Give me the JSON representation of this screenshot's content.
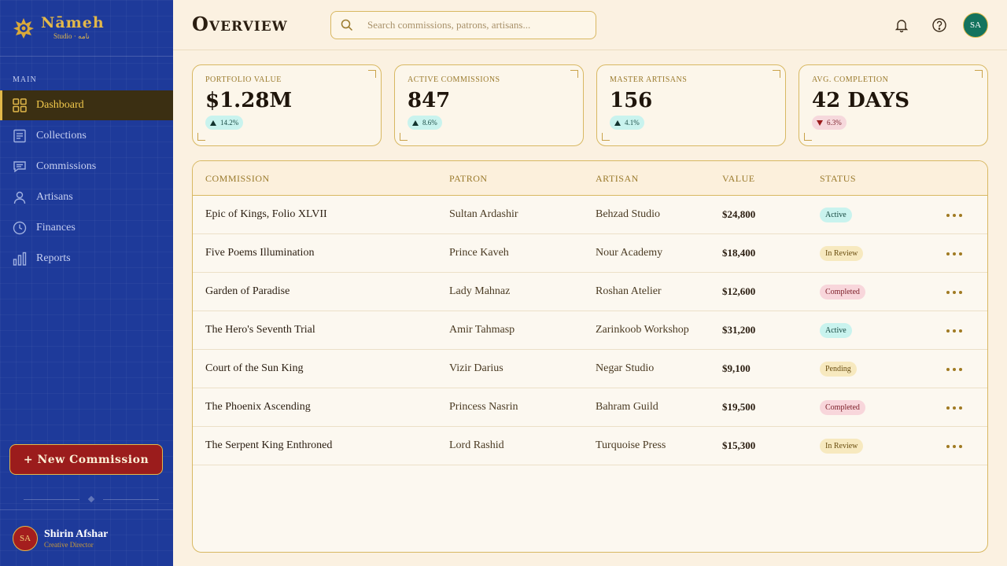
{
  "brand": {
    "name": "Nāmeh",
    "sub": "Studio · نامه"
  },
  "sidebar": {
    "section_label": "MAIN",
    "items": [
      {
        "label": "Dashboard",
        "icon": "grid-icon",
        "active": true
      },
      {
        "label": "Collections",
        "icon": "document-icon"
      },
      {
        "label": "Commissions",
        "icon": "chat-icon"
      },
      {
        "label": "Artisans",
        "icon": "person-icon"
      },
      {
        "label": "Finances",
        "icon": "clock-icon"
      },
      {
        "label": "Reports",
        "icon": "bar-chart-icon"
      }
    ],
    "new_button": "+ New Commission",
    "user": {
      "initials": "SA",
      "name": "Shirin Afshar",
      "role": "Creative Director"
    }
  },
  "header": {
    "title": "Overview",
    "search_placeholder": "Search commissions, patrons, artisans...",
    "avatar_initials": "SA"
  },
  "stats": [
    {
      "label": "PORTFOLIO VALUE",
      "value": "$1.28M",
      "change": "14.2%",
      "direction": "up"
    },
    {
      "label": "ACTIVE COMMISSIONS",
      "value": "847",
      "change": "8.6%",
      "direction": "up"
    },
    {
      "label": "MASTER ARTISANS",
      "value": "156",
      "change": "4.1%",
      "direction": "up"
    },
    {
      "label": "AVG. COMPLETION",
      "value": "42 DAYS",
      "change": "6.3%",
      "direction": "down"
    }
  ],
  "table": {
    "columns": [
      "COMMISSION",
      "PATRON",
      "ARTISAN",
      "VALUE",
      "STATUS"
    ],
    "rows": [
      {
        "commission": "Epic of Kings, Folio XLVII",
        "patron": "Sultan Ardashir",
        "artisan": "Behzad Studio",
        "value": "$24,800",
        "status": "Active"
      },
      {
        "commission": "Five Poems Illumination",
        "patron": "Prince Kaveh",
        "artisan": "Nour Academy",
        "value": "$18,400",
        "status": "In Review"
      },
      {
        "commission": "Garden of Paradise",
        "patron": "Lady Mahnaz",
        "artisan": "Roshan Atelier",
        "value": "$12,600",
        "status": "Completed"
      },
      {
        "commission": "The Hero's Seventh Trial",
        "patron": "Amir Tahmasp",
        "artisan": "Zarinkoob Workshop",
        "value": "$31,200",
        "status": "Active"
      },
      {
        "commission": "Court of the Sun King",
        "patron": "Vizir Darius",
        "artisan": "Negar Studio",
        "value": "$9,100",
        "status": "Pending"
      },
      {
        "commission": "The Phoenix Ascending",
        "patron": "Princess Nasrin",
        "artisan": "Bahram Guild",
        "value": "$19,500",
        "status": "Completed"
      },
      {
        "commission": "The Serpent King Enthroned",
        "patron": "Lord Rashid",
        "artisan": "Turquoise Press",
        "value": "$15,300",
        "status": "In Review"
      }
    ]
  },
  "colors": {
    "sidebar_bg": "#1e3a9a",
    "accent_gold": "#e2b84a",
    "primary_red": "#9b1c1c",
    "teal": "#14735e",
    "page_bg": "#fbf1e1"
  }
}
